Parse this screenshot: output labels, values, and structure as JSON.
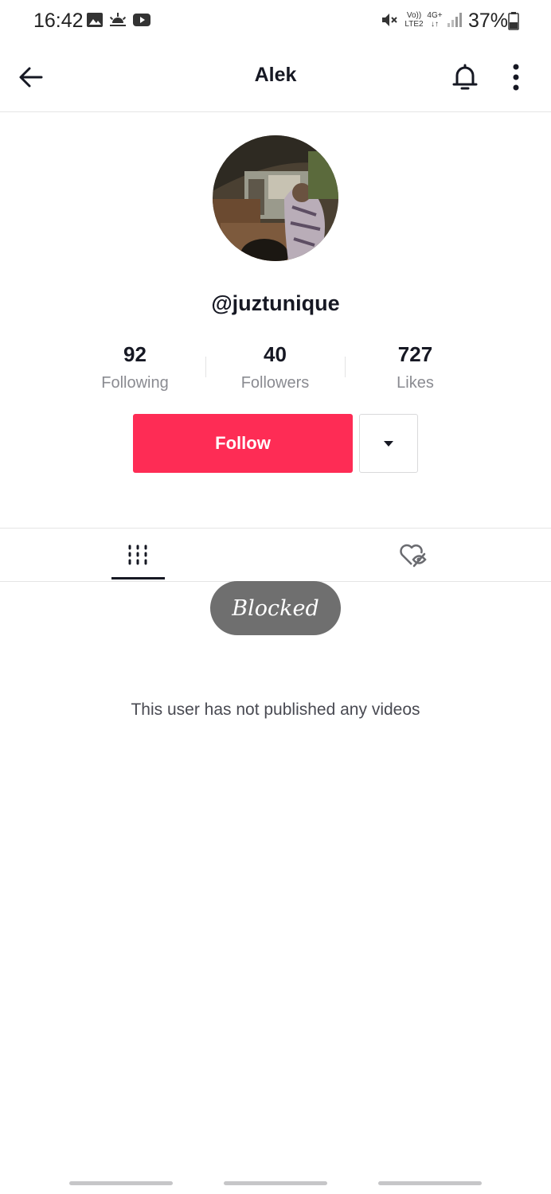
{
  "status_bar": {
    "time": "16:42",
    "network_top": "Vo))",
    "network_bottom": "LTE2",
    "data_type": "4G+",
    "battery": "37%",
    "icons": [
      "gallery-icon",
      "weather-icon",
      "youtube-icon",
      "mute-icon",
      "signal-icon",
      "battery-icon"
    ]
  },
  "header": {
    "title": "Alek",
    "icons": [
      "back-arrow-icon",
      "bell-icon",
      "more-vertical-icon"
    ]
  },
  "profile": {
    "username": "@juztunique",
    "stats": [
      {
        "value": "92",
        "label": "Following"
      },
      {
        "value": "40",
        "label": "Followers"
      },
      {
        "value": "727",
        "label": "Likes"
      }
    ],
    "follow_label": "Follow",
    "accent_color": "#fe2c55"
  },
  "tabs": [
    {
      "name": "videos-tab",
      "icon": "grid-icon",
      "active": true
    },
    {
      "name": "liked-tab",
      "icon": "hidden-heart-icon",
      "active": false
    }
  ],
  "toast": {
    "label": "Blocked"
  },
  "empty_state": {
    "text": "This user has not published any videos"
  }
}
